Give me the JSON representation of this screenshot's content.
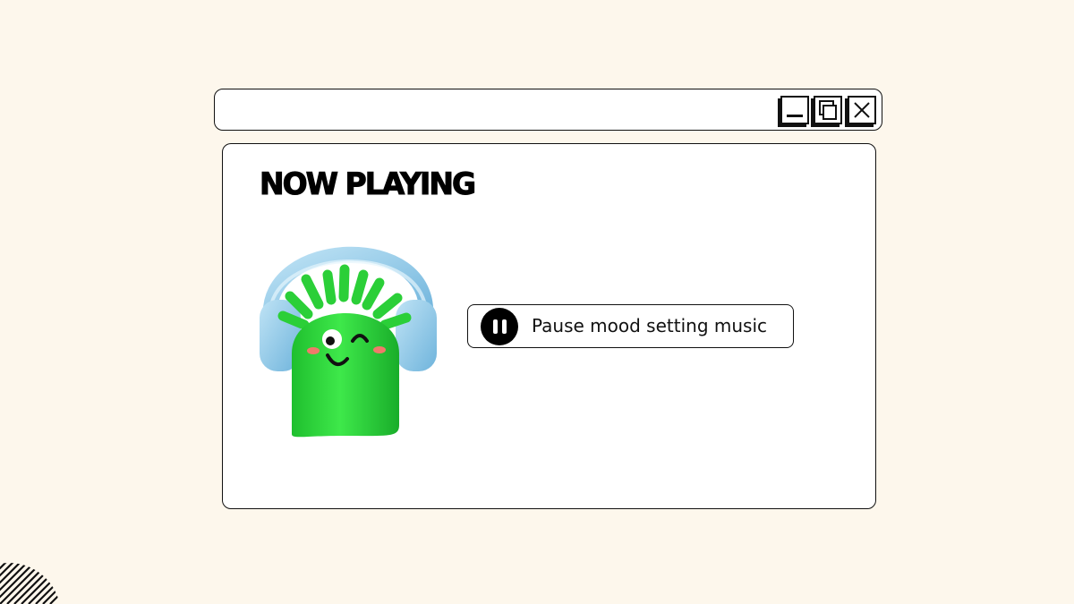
{
  "window": {
    "controls": [
      {
        "name": "minimize",
        "icon": "minimize-icon"
      },
      {
        "name": "maximize",
        "icon": "restore-icon"
      },
      {
        "name": "close",
        "icon": "close-icon"
      }
    ]
  },
  "main": {
    "heading": "NOW PLAYING",
    "music_button": {
      "label": "Pause mood setting music",
      "icon": "pause-icon"
    },
    "illustration": "green-monster-with-headphones"
  },
  "colors": {
    "background": "#fdf7ec",
    "panel": "#ffffff",
    "border": "#111111",
    "mascot_green": "#2fd63c",
    "headphones_blue": "#8cc6e6"
  }
}
